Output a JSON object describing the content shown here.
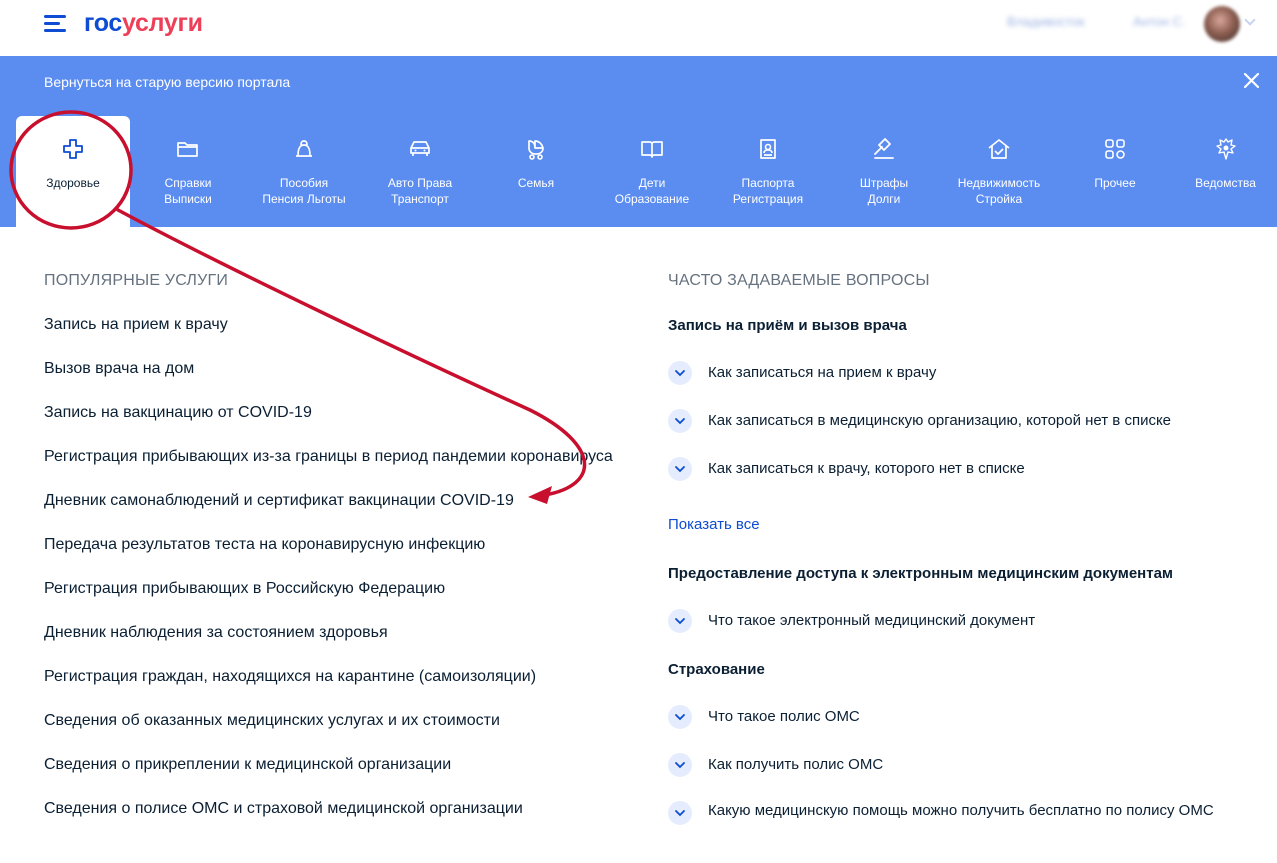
{
  "header": {
    "logo_part1": "гос",
    "logo_part2": "услуги",
    "link_a": "Владивосток",
    "link_b": "Антон С."
  },
  "banner": {
    "text": "Вернуться на старую версию портала"
  },
  "categories": [
    {
      "label": "Здоровье",
      "icon": "health-cross-icon"
    },
    {
      "label": "Справки\nВыписки",
      "icon": "folder-icon"
    },
    {
      "label": "Пособия\nПенсия Льготы",
      "icon": "piggy-icon"
    },
    {
      "label": "Авто Права\nТранспорт",
      "icon": "car-icon"
    },
    {
      "label": "Семья",
      "icon": "stroller-icon"
    },
    {
      "label": "Дети\nОбразование",
      "icon": "book-icon"
    },
    {
      "label": "Паспорта\nРегистрация",
      "icon": "passport-icon"
    },
    {
      "label": "Штрафы\nДолги",
      "icon": "gavel-icon"
    },
    {
      "label": "Недвижимость\nСтройка",
      "icon": "house-icon"
    },
    {
      "label": "Прочее",
      "icon": "grid-icon"
    },
    {
      "label": "Ведомства",
      "icon": "emblem-icon"
    }
  ],
  "popular": {
    "title": "ПОПУЛЯРНЫЕ УСЛУГИ",
    "items": [
      "Запись на прием к врачу",
      "Вызов врача на дом",
      "Запись на вакцинацию от COVID-19",
      "Регистрация прибывающих из-за границы в период пандемии коронавируса",
      "Дневник самонаблюдений и сертификат вакцинации COVID-19",
      "Передача результатов теста на коронавирусную инфекцию",
      "Регистрация прибывающих в Российскую Федерацию",
      "Дневник наблюдения за состоянием здоровья",
      "Регистрация граждан, находящихся на карантине (самоизоляции)",
      "Сведения об оказанных медицинских услугах и их стоимости",
      "Сведения о прикреплении к медицинской организации",
      "Сведения о полисе ОМС и страховой медицинской организации"
    ]
  },
  "faq": {
    "title": "ЧАСТО ЗАДАВАЕМЫЕ ВОПРОСЫ",
    "group1": "Запись на приём и вызов врача",
    "group1_items": [
      "Как записаться на прием к врачу",
      "Как записаться в медицинскую организацию, которой нет в списке",
      "Как записаться к врачу, которого нет в списке"
    ],
    "show_all": "Показать все",
    "group2": "Предоставление доступа к электронным медицинским документам",
    "group2_items": [
      "Что такое электронный медицинский документ"
    ],
    "group3": "Страхование",
    "group3_items": [
      "Что такое полис ОМС",
      "Как получить полис ОМС",
      "Какую медицинскую помощь можно получить бесплатно по полису ОМС"
    ]
  },
  "colors": {
    "primary": "#0d4cd3",
    "nav_bg": "#5b8cf0",
    "accent_red": "#ee3f58",
    "annotation": "#c8102e"
  }
}
